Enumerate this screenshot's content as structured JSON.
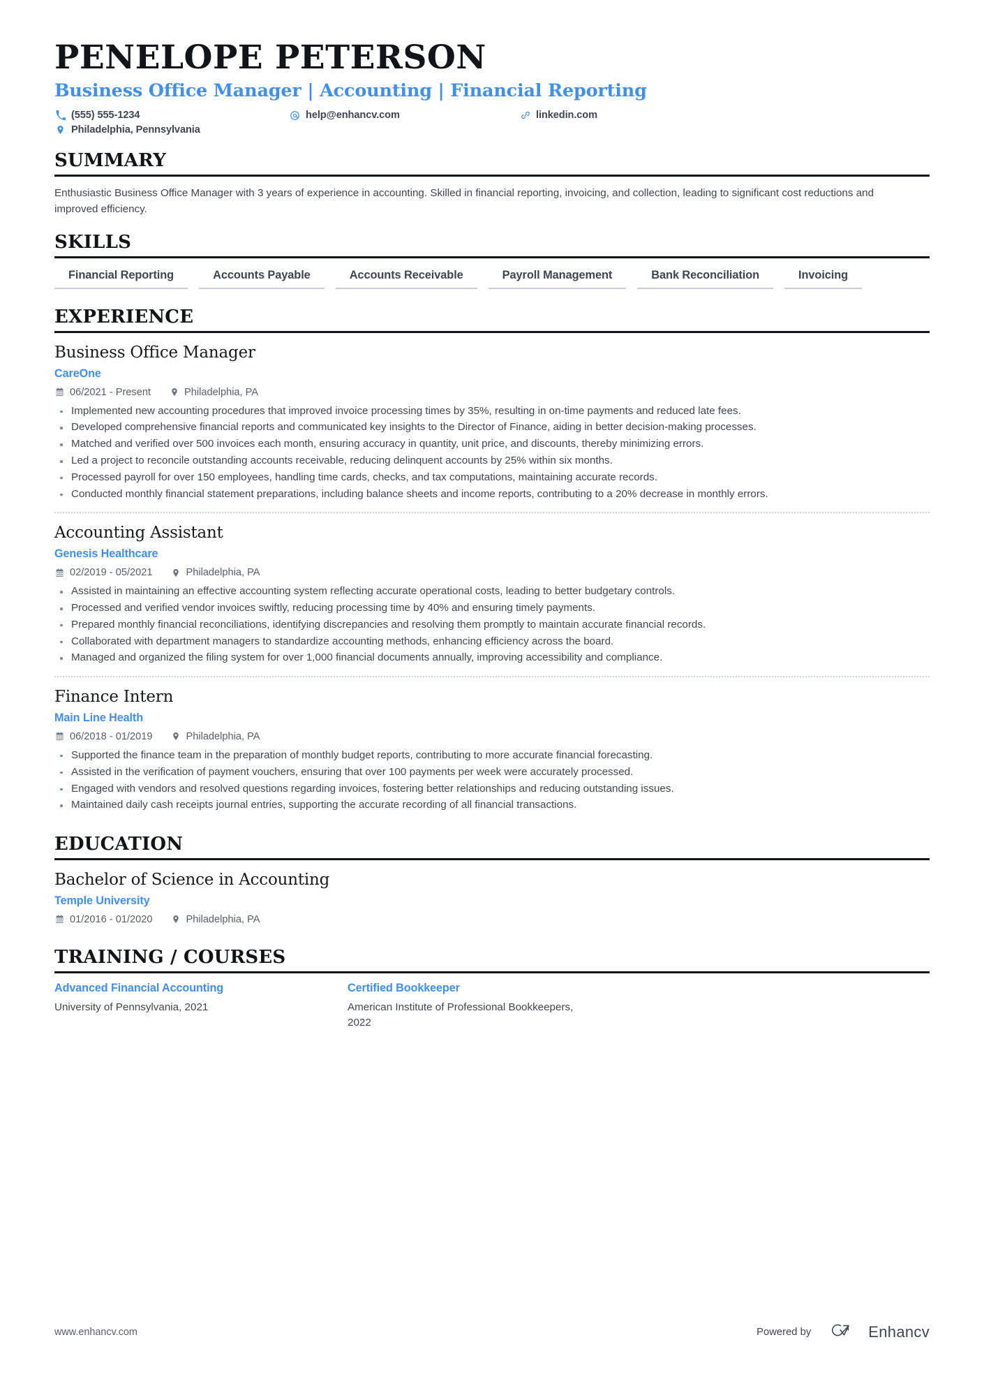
{
  "header": {
    "name": "PENELOPE PETERSON",
    "headline": "Business Office Manager | Accounting | Financial Reporting",
    "contacts": [
      {
        "icon": "phone-icon",
        "text": "(555) 555-1234"
      },
      {
        "icon": "email-icon",
        "text": "help@enhancv.com"
      },
      {
        "icon": "link-icon",
        "text": "linkedin.com"
      },
      {
        "icon": "location-pin-icon",
        "text": "Philadelphia, Pennsylvania"
      }
    ]
  },
  "summary": {
    "title": "SUMMARY",
    "text": "Enthusiastic Business Office Manager with 3 years of experience in accounting. Skilled in financial reporting, invoicing, and collection, leading to significant cost reductions and improved efficiency."
  },
  "skills": {
    "title": "SKILLS",
    "items": [
      "Financial Reporting",
      "Accounts Payable",
      "Accounts Receivable",
      "Payroll Management",
      "Bank Reconciliation",
      "Invoicing"
    ]
  },
  "experience": {
    "title": "EXPERIENCE",
    "entries": [
      {
        "role": "Business Office Manager",
        "company": "CareOne",
        "dates": "06/2021 - Present",
        "location": "Philadelphia, PA",
        "bullets": [
          "Implemented new accounting procedures that improved invoice processing times by 35%, resulting in on-time payments and reduced late fees.",
          "Developed comprehensive financial reports and communicated key insights to the Director of Finance, aiding in better decision-making processes.",
          "Matched and verified over 500 invoices each month, ensuring accuracy in quantity, unit price, and discounts, thereby minimizing errors.",
          "Led a project to reconcile outstanding accounts receivable, reducing delinquent accounts by 25% within six months.",
          "Processed payroll for over 150 employees, handling time cards, checks, and tax computations, maintaining accurate records.",
          "Conducted monthly financial statement preparations, including balance sheets and income reports, contributing to a 20% decrease in monthly errors."
        ]
      },
      {
        "role": "Accounting Assistant",
        "company": "Genesis Healthcare",
        "dates": "02/2019 - 05/2021",
        "location": "Philadelphia, PA",
        "bullets": [
          "Assisted in maintaining an effective accounting system reflecting accurate operational costs, leading to better budgetary controls.",
          "Processed and verified vendor invoices swiftly, reducing processing time by 40% and ensuring timely payments.",
          "Prepared monthly financial reconciliations, identifying discrepancies and resolving them promptly to maintain accurate financial records.",
          "Collaborated with department managers to standardize accounting methods, enhancing efficiency across the board.",
          "Managed and organized the filing system for over 1,000 financial documents annually, improving accessibility and compliance."
        ]
      },
      {
        "role": "Finance Intern",
        "company": "Main Line Health",
        "dates": "06/2018 - 01/2019",
        "location": "Philadelphia, PA",
        "bullets": [
          "Supported the finance team in the preparation of monthly budget reports, contributing to more accurate financial forecasting.",
          "Assisted in the verification of payment vouchers, ensuring that over 100 payments per week were accurately processed.",
          "Engaged with vendors and resolved questions regarding invoices, fostering better relationships and reducing outstanding issues.",
          "Maintained daily cash receipts journal entries, supporting the accurate recording of all financial transactions."
        ]
      }
    ]
  },
  "education": {
    "title": "EDUCATION",
    "entries": [
      {
        "degree": "Bachelor of Science in Accounting",
        "school": "Temple University",
        "dates": "01/2016 - 01/2020",
        "location": "Philadelphia, PA"
      }
    ]
  },
  "training": {
    "title": "TRAINING / COURSES",
    "courses": [
      {
        "name": "Advanced Financial Accounting",
        "provider": "University of Pennsylvania, 2021"
      },
      {
        "name": "Certified Bookkeeper",
        "provider": "American Institute of Professional Bookkeepers, 2022"
      }
    ]
  },
  "footer": {
    "url": "www.enhancv.com",
    "powered_by": "Powered by",
    "brand": "Enhancv"
  },
  "colors": {
    "accent": "#3f8fef",
    "text": "#3d4752",
    "heading": "#111418"
  }
}
